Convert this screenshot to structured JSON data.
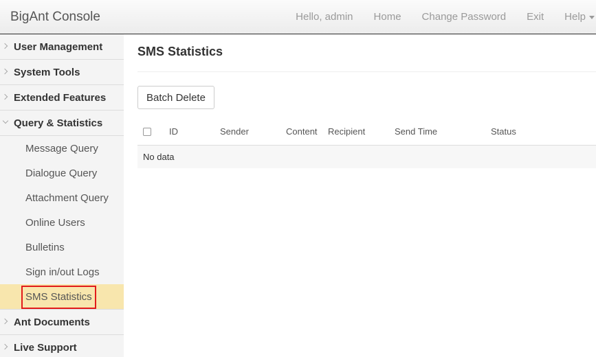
{
  "header": {
    "brand": "BigAnt Console",
    "greeting": "Hello, admin",
    "links": {
      "home": "Home",
      "change_password": "Change Password",
      "exit": "Exit",
      "help": "Help"
    }
  },
  "sidebar": {
    "groups": [
      {
        "label": "User Management"
      },
      {
        "label": "System Tools"
      },
      {
        "label": "Extended Features"
      },
      {
        "label": "Query & Statistics"
      },
      {
        "label": "Ant Documents"
      },
      {
        "label": "Live Support"
      }
    ],
    "submenu": [
      {
        "label": "Message Query"
      },
      {
        "label": "Dialogue Query"
      },
      {
        "label": "Attachment Query"
      },
      {
        "label": "Online Users"
      },
      {
        "label": "Bulletins"
      },
      {
        "label": "Sign in/out Logs"
      },
      {
        "label": "SMS Statistics"
      }
    ],
    "active_item": "SMS Statistics"
  },
  "main": {
    "title": "SMS Statistics",
    "batch_delete_label": "Batch Delete",
    "table": {
      "columns": {
        "id": "ID",
        "sender": "Sender",
        "content": "Content",
        "recipient": "Recipient",
        "send_time": "Send Time",
        "status": "Status"
      },
      "empty_text": "No data"
    }
  },
  "colors": {
    "active_item_bg": "#f8e6ad",
    "highlight_border": "#e21a1a",
    "sidebar_bg": "#f4f4f4"
  }
}
